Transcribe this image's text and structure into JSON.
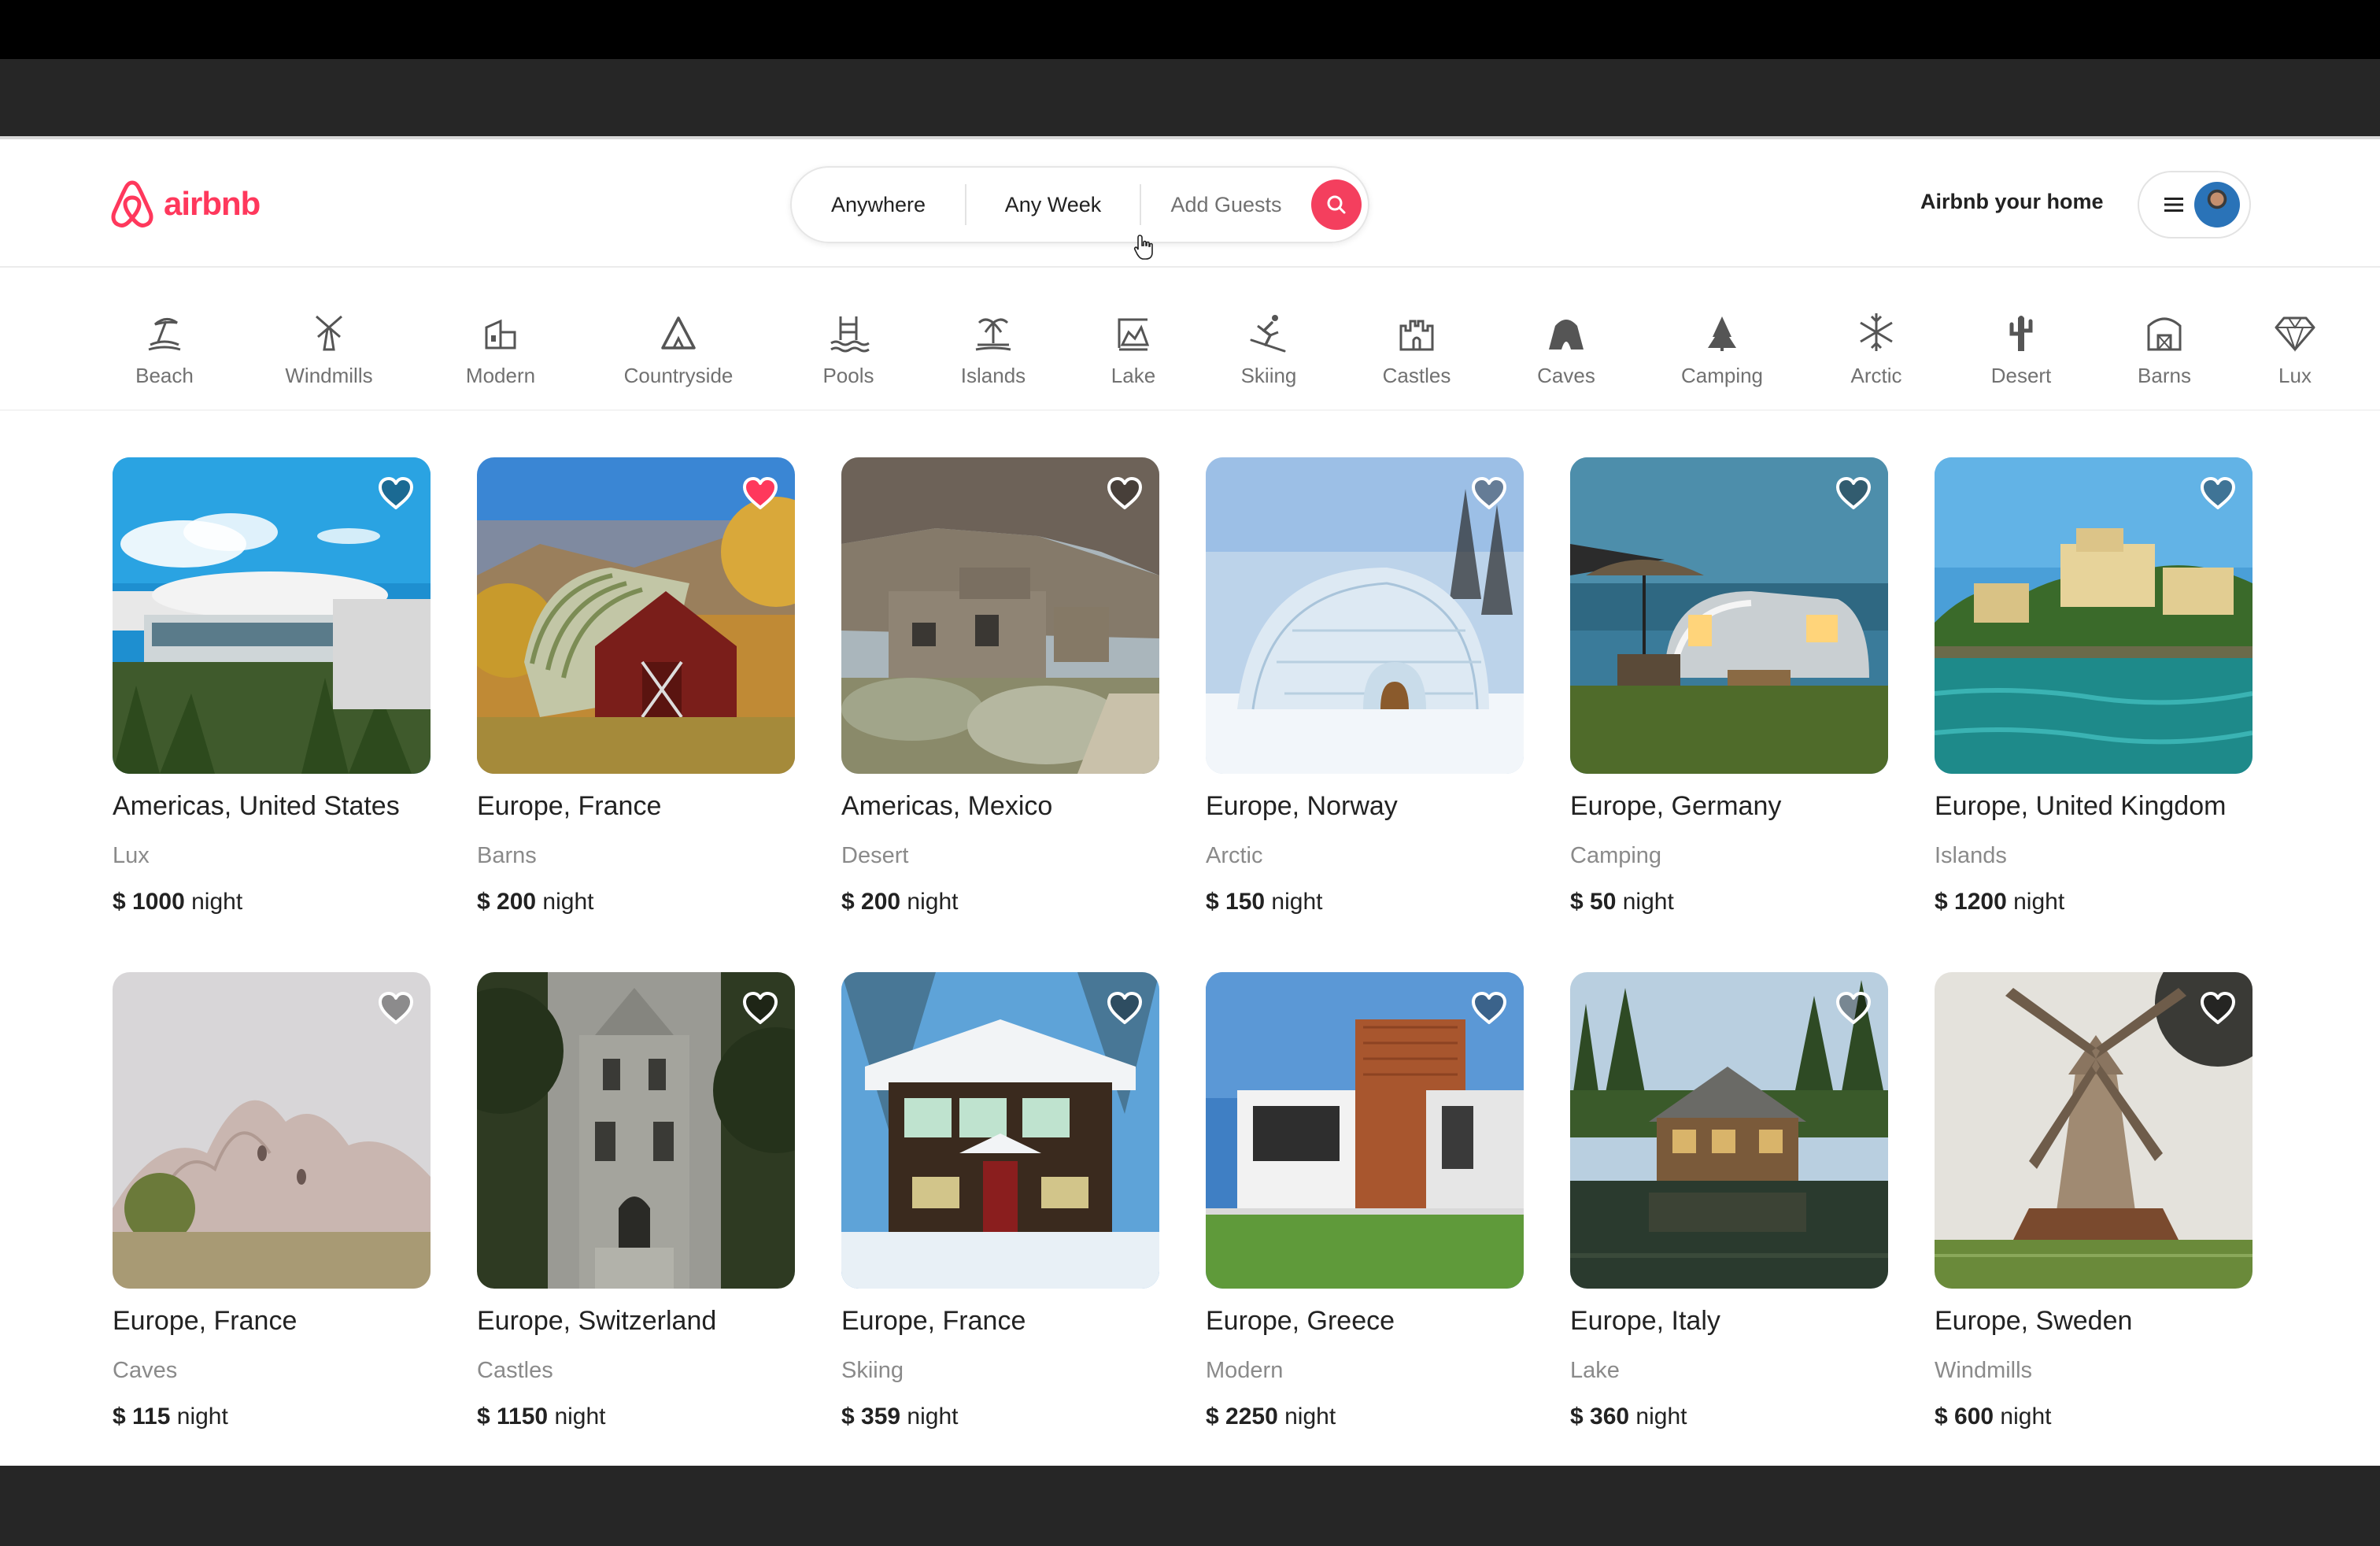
{
  "brand": {
    "name": "airbnb",
    "color": "#ff385c"
  },
  "search": {
    "location": "Anywhere",
    "week": "Any Week",
    "guests": "Add Guests",
    "button_icon": "search-icon"
  },
  "header": {
    "host_link": "Airbnb your home",
    "menu_icon": "hamburger-icon",
    "avatar": "user-avatar"
  },
  "categories": [
    {
      "label": "Beach",
      "icon": "beach-icon"
    },
    {
      "label": "Windmills",
      "icon": "windmill-icon"
    },
    {
      "label": "Modern",
      "icon": "modern-house-icon"
    },
    {
      "label": "Countryside",
      "icon": "countryside-icon"
    },
    {
      "label": "Pools",
      "icon": "pool-icon"
    },
    {
      "label": "Islands",
      "icon": "island-icon"
    },
    {
      "label": "Lake",
      "icon": "lake-icon"
    },
    {
      "label": "Skiing",
      "icon": "skiing-icon"
    },
    {
      "label": "Castles",
      "icon": "castle-icon"
    },
    {
      "label": "Caves",
      "icon": "cave-icon"
    },
    {
      "label": "Camping",
      "icon": "camping-icon"
    },
    {
      "label": "Arctic",
      "icon": "snowflake-icon"
    },
    {
      "label": "Desert",
      "icon": "cactus-icon"
    },
    {
      "label": "Barns",
      "icon": "barn-icon"
    },
    {
      "label": "Lux",
      "icon": "diamond-icon"
    }
  ],
  "listings": [
    {
      "location": "Americas, United States",
      "category": "Lux",
      "price": "$ 1000",
      "unit": "night",
      "favorited": false,
      "photo": "circular-mansion-beach"
    },
    {
      "location": "Europe, France",
      "category": "Barns",
      "price": "$ 200",
      "unit": "night",
      "favorited": true,
      "photo": "red-barn-autumn"
    },
    {
      "location": "Americas, Mexico",
      "category": "Desert",
      "price": "$ 200",
      "unit": "night",
      "favorited": false,
      "photo": "desert-stone-house"
    },
    {
      "location": "Europe, Norway",
      "category": "Arctic",
      "price": "$ 150",
      "unit": "night",
      "favorited": false,
      "photo": "igloo-snow"
    },
    {
      "location": "Europe, Germany",
      "category": "Camping",
      "price": "$ 50",
      "unit": "night",
      "favorited": false,
      "photo": "airstream-trailer"
    },
    {
      "location": "Europe, United Kingdom",
      "category": "Islands",
      "price": "$ 1200",
      "unit": "night",
      "favorited": false,
      "photo": "lakeside-villa"
    },
    {
      "location": "Europe, France",
      "category": "Caves",
      "price": "$ 115",
      "unit": "night",
      "favorited": false,
      "photo": "cave-rock-formations"
    },
    {
      "location": "Europe, Switzerland",
      "category": "Castles",
      "price": "$ 1150",
      "unit": "night",
      "favorited": false,
      "photo": "stone-castle"
    },
    {
      "location": "Europe, France",
      "category": "Skiing",
      "price": "$ 359",
      "unit": "night",
      "favorited": false,
      "photo": "snowy-log-cabin"
    },
    {
      "location": "Europe, Greece",
      "category": "Modern",
      "price": "$ 2250",
      "unit": "night",
      "favorited": false,
      "photo": "modern-house"
    },
    {
      "location": "Europe, Italy",
      "category": "Lake",
      "price": "$ 360",
      "unit": "night",
      "favorited": false,
      "photo": "lake-cabin"
    },
    {
      "location": "Europe, Sweden",
      "category": "Windmills",
      "price": "$ 600",
      "unit": "night",
      "favorited": false,
      "photo": "wooden-windmill"
    }
  ]
}
